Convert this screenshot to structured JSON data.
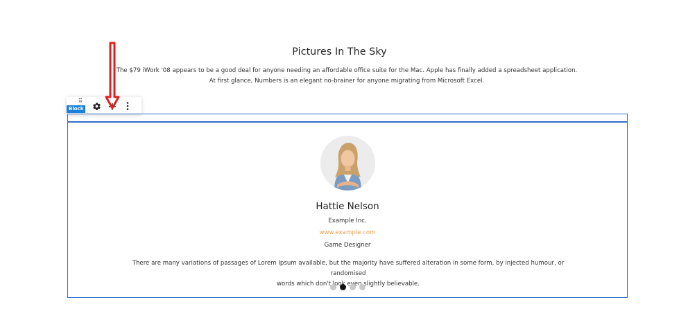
{
  "section": {
    "title": "Pictures In The Sky",
    "description_line1": "The $79 iWork '08 appears to be a good deal for anyone needing an affordable office suite for the Mac. Apple has finally added a spreadsheet application.",
    "description_line2": "At first glance, Numbers is an elegant no-brainer for anyone migrating from Microsoft Excel."
  },
  "toolbar": {
    "badge": "Block",
    "drag_glyph": "⠿",
    "settings_icon": "gear-icon",
    "add_icon": "plus-icon",
    "add_glyph": "+",
    "more_icon": "kebab-icon"
  },
  "annotation": {
    "arrow_color": "#e02020"
  },
  "testimonial": {
    "name": "Hattie Nelson",
    "company": "Example Inc.",
    "website": "www.example.com",
    "role": "Game Designer",
    "quote_line1": "There are many variations of passages of Lorem Ipsum available, but the majority have suffered alteration in some form, by injected humour, or randomised",
    "quote_line2": "words which don't look even slightly believable.",
    "slides": 4,
    "active_slide": 2
  },
  "colors": {
    "accent": "#2d6ec9",
    "link": "#f0a050",
    "badge": "#1e7fd8"
  }
}
